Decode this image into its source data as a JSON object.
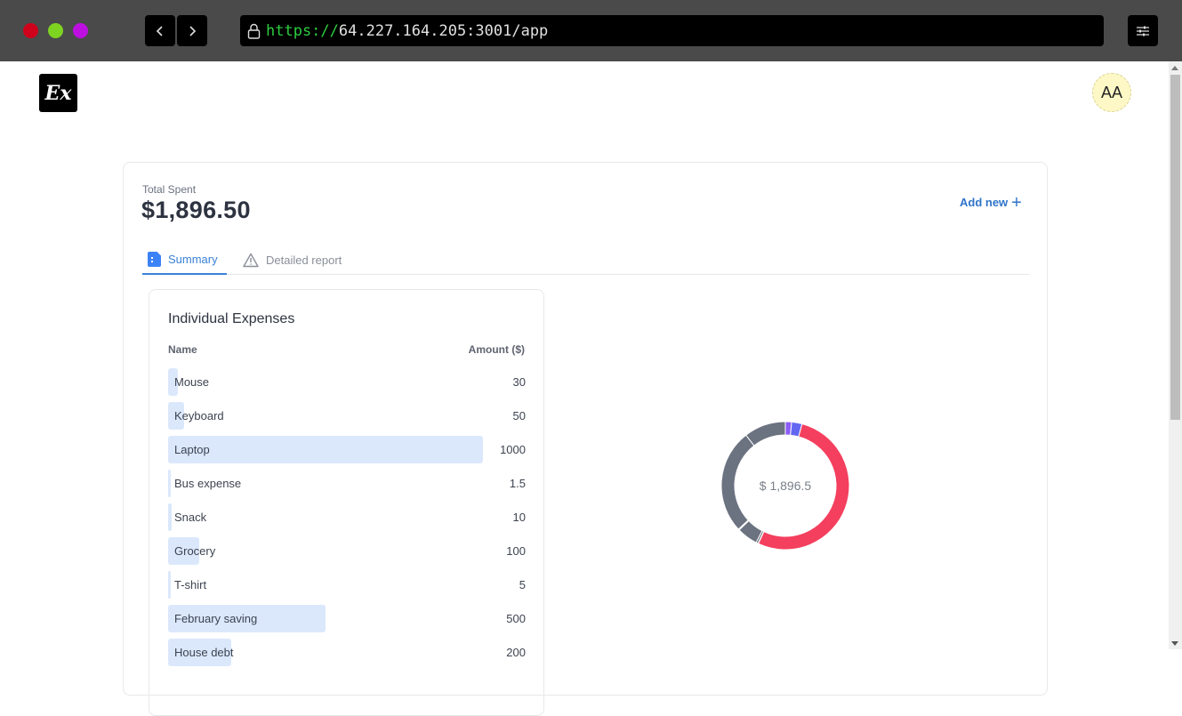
{
  "browser": {
    "url_protocol": "https://",
    "url_rest": "64.227.164.205:3001/app",
    "back_icon": "chevron-left-icon",
    "forward_icon": "chevron-right-icon",
    "lock_icon": "lock-icon",
    "menu_icon": "sliders-icon"
  },
  "app": {
    "logo_text": "Ex",
    "avatar_initials": "AA"
  },
  "summary": {
    "total_label": "Total Spent",
    "total_value": "$1,896.50",
    "add_new_label": "Add new",
    "add_new_icon": "+"
  },
  "tabs": [
    {
      "label": "Summary",
      "icon": "document-icon",
      "active": true
    },
    {
      "label": "Detailed report",
      "icon": "warning-icon",
      "active": false
    }
  ],
  "expenses": {
    "title": "Individual Expenses",
    "col_name": "Name",
    "col_amount": "Amount ($)",
    "max_value": 1000,
    "items": [
      {
        "name": "Mouse",
        "amount": "30",
        "value": 30
      },
      {
        "name": "Keyboard",
        "amount": "50",
        "value": 50
      },
      {
        "name": "Laptop",
        "amount": "1000",
        "value": 1000
      },
      {
        "name": "Bus expense",
        "amount": "1.5",
        "value": 1.5
      },
      {
        "name": "Snack",
        "amount": "10",
        "value": 10
      },
      {
        "name": "Grocery",
        "amount": "100",
        "value": 100
      },
      {
        "name": "T-shirt",
        "amount": "5",
        "value": 5
      },
      {
        "name": "February saving",
        "amount": "500",
        "value": 500
      },
      {
        "name": "House debt",
        "amount": "200",
        "value": 200
      }
    ]
  },
  "chart_data": {
    "type": "pie",
    "variant": "donut",
    "center_label": "$ 1,896.5",
    "total": 1896.5,
    "categories": [
      "Mouse",
      "Keyboard",
      "Laptop",
      "Bus expense",
      "Snack",
      "Grocery",
      "T-shirt",
      "February saving",
      "House debt"
    ],
    "values": [
      30,
      50,
      1000,
      1.5,
      10,
      100,
      5,
      500,
      200
    ],
    "colors": [
      "#8b5cf6",
      "#6366f1",
      "#f43f5e",
      "#f59e0b",
      "#6b7280",
      "#6b7280",
      "#6b7280",
      "#6b7280",
      "#6b7280"
    ],
    "start": "top",
    "direction": "clockwise"
  }
}
